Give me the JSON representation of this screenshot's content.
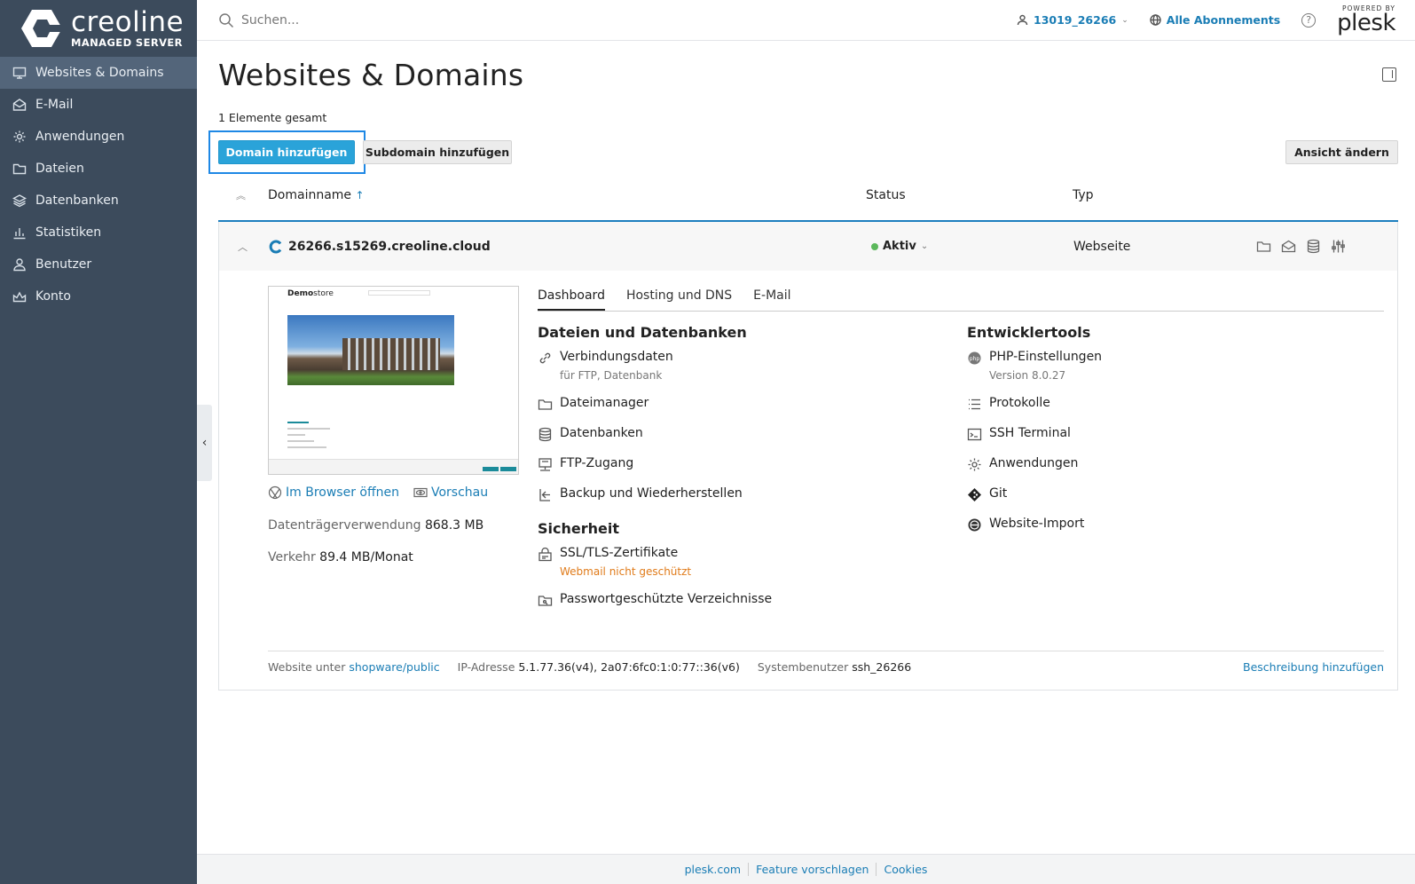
{
  "brand": {
    "name": "creoline",
    "subtitle": "MANAGED SERVER"
  },
  "sidebar": {
    "items": [
      {
        "label": "Websites & Domains",
        "icon": "monitor-icon",
        "active": true
      },
      {
        "label": "E-Mail",
        "icon": "envelope-icon"
      },
      {
        "label": "Anwendungen",
        "icon": "gear-icon"
      },
      {
        "label": "Dateien",
        "icon": "folder-icon"
      },
      {
        "label": "Datenbanken",
        "icon": "layers-icon"
      },
      {
        "label": "Statistiken",
        "icon": "bar-chart-icon"
      },
      {
        "label": "Benutzer",
        "icon": "user-icon"
      },
      {
        "label": "Konto",
        "icon": "crown-icon"
      }
    ]
  },
  "header": {
    "search_placeholder": "Suchen...",
    "user": "13019_26266",
    "subscriptions": "Alle Abonnements",
    "powered_by": "POWERED BY",
    "plesk": "plesk"
  },
  "page": {
    "title": "Websites & Domains",
    "total": "1 Elemente gesamt",
    "buttons": {
      "add_domain": "Domain hinzufügen",
      "add_subdomain": "Subdomain hinzufügen",
      "change_view": "Ansicht ändern"
    },
    "columns": {
      "name": "Domainname",
      "sort_arrow": "↑",
      "status": "Status",
      "type": "Typ"
    }
  },
  "domain": {
    "name": "26266.s15269.creoline.cloud",
    "status": "Aktiv",
    "type": "Webseite",
    "preview": {
      "brand_bold": "Demo",
      "brand_rest": "store"
    },
    "open_in_browser": "Im Browser öffnen",
    "preview_link": "Vorschau",
    "disk_label": "Datenträgerverwendung",
    "disk_value": "868.3 MB",
    "traffic_label": "Verkehr",
    "traffic_value": "89.4 MB/Monat",
    "tabs": [
      "Dashboard",
      "Hosting und DNS",
      "E-Mail"
    ],
    "files_title": "Dateien und Datenbanken",
    "files": [
      {
        "label": "Verbindungsdaten",
        "sub": "für FTP, Datenbank"
      },
      {
        "label": "Dateimanager"
      },
      {
        "label": "Datenbanken"
      },
      {
        "label": "FTP-Zugang"
      },
      {
        "label": "Backup und Wiederherstellen"
      }
    ],
    "security_title": "Sicherheit",
    "security": [
      {
        "label": "SSL/TLS-Zertifikate",
        "warning": "Webmail nicht geschützt"
      },
      {
        "label": "Passwortgeschützte Verzeichnisse"
      }
    ],
    "dev_title": "Entwicklertools",
    "dev": [
      {
        "label": "PHP-Einstellungen",
        "sub": "Version 8.0.27"
      },
      {
        "label": "Protokolle"
      },
      {
        "label": "SSH Terminal"
      },
      {
        "label": "Anwendungen"
      },
      {
        "label": "Git"
      },
      {
        "label": "Website-Import"
      }
    ],
    "info": {
      "website_label": "Website unter",
      "website_path": "shopware/public",
      "ip_label": "IP-Adresse",
      "ip_value": "5.1.77.36(v4), 2a07:6fc0:1:0:77::36(v6)",
      "sysuser_label": "Systembenutzer",
      "sysuser_value": "ssh_26266",
      "add_description": "Beschreibung hinzufügen"
    }
  },
  "footer": {
    "links": [
      "plesk.com",
      "Feature vorschlagen",
      "Cookies"
    ]
  },
  "colors": {
    "sidebar": "#3c4b5c",
    "sidebar_active": "#53657a",
    "primary": "#2aa3d9",
    "link": "#1a7db5",
    "status_ok": "#5cb85c",
    "warning": "#e07b1a"
  }
}
